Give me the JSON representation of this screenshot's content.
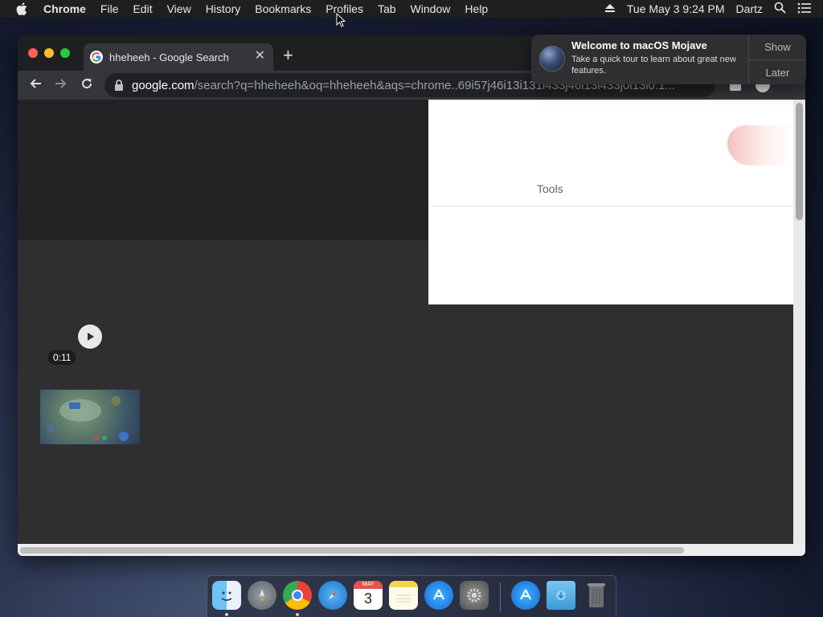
{
  "menubar": {
    "app_name": "Chrome",
    "items": [
      "File",
      "Edit",
      "View",
      "History",
      "Bookmarks",
      "Profiles",
      "Tab",
      "Window",
      "Help"
    ],
    "clock": "Tue May 3  9:24 PM",
    "user": "Dartz"
  },
  "browser": {
    "tab_title": "hheheeh - Google Search",
    "url_host": "google.com",
    "url_rest": "/search?q=hheheeh&oq=hheheeh&aqs=chrome..69i57j46i13i131i433j46i13i433j0i13i0.1..."
  },
  "content": {
    "tools_label": "Tools",
    "video_duration": "0:11"
  },
  "notification": {
    "title": "Welcome to macOS Mojave",
    "body": "Take a quick tour to learn about great new features.",
    "show_label": "Show",
    "later_label": "Later"
  },
  "dock": {
    "calendar_day": "3",
    "calendar_month": "MAY"
  },
  "colors": {
    "menubar_bg": "#1f1f21",
    "tab_active_bg": "#35363a",
    "content_bg": "#2f2f31",
    "google_blue": "#4285f4",
    "google_red": "#ea4335",
    "google_yellow": "#fbbc05",
    "google_green": "#34a853"
  }
}
